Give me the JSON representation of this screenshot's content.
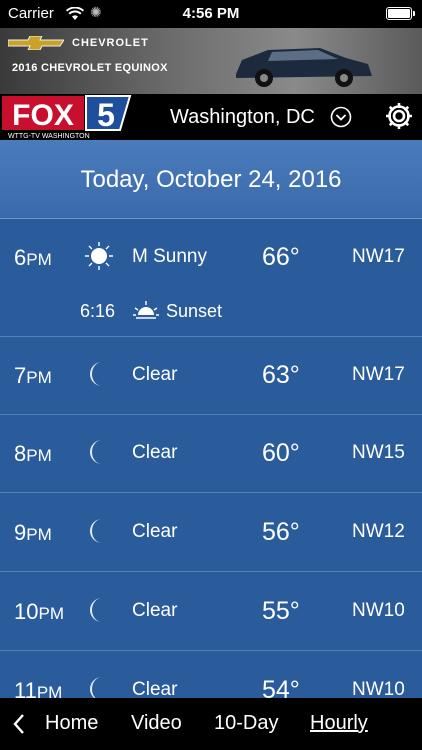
{
  "status_bar": {
    "carrier": "Carrier",
    "time": "4:56 PM"
  },
  "ad": {
    "brand": "CHEVROLET",
    "model": "2016 CHEVROLET EQUINOX"
  },
  "header": {
    "logo_main": "FOX",
    "logo_number": "5",
    "logo_sub": "WTTG-TV WASHINGTON",
    "location": "Washington, DC"
  },
  "date": "Today, October 24, 2016",
  "hourly": [
    {
      "hour": "6",
      "ampm": "PM",
      "icon": "sun-icon",
      "condition": "M Sunny",
      "temp": "66°",
      "wind": "NW17",
      "sunset": {
        "time": "6:16",
        "label": "Sunset"
      }
    },
    {
      "hour": "7",
      "ampm": "PM",
      "icon": "moon-icon",
      "condition": "Clear",
      "temp": "63°",
      "wind": "NW17"
    },
    {
      "hour": "8",
      "ampm": "PM",
      "icon": "moon-icon",
      "condition": "Clear",
      "temp": "60°",
      "wind": "NW15"
    },
    {
      "hour": "9",
      "ampm": "PM",
      "icon": "moon-icon",
      "condition": "Clear",
      "temp": "56°",
      "wind": "NW12"
    },
    {
      "hour": "10",
      "ampm": "PM",
      "icon": "moon-icon",
      "condition": "Clear",
      "temp": "55°",
      "wind": "NW10"
    },
    {
      "hour": "11",
      "ampm": "PM",
      "icon": "moon-icon",
      "condition": "Clear",
      "temp": "54°",
      "wind": "NW10"
    }
  ],
  "nav": {
    "back_icon": "chevron-left-icon",
    "home": "Home",
    "video": "Video",
    "ten_day": "10-Day",
    "hourly": "Hourly",
    "active": "hourly"
  },
  "colors": {
    "list_bg": "#2a5c9c",
    "header_bg": "#000000",
    "date_bar": "#4a7bbb"
  }
}
